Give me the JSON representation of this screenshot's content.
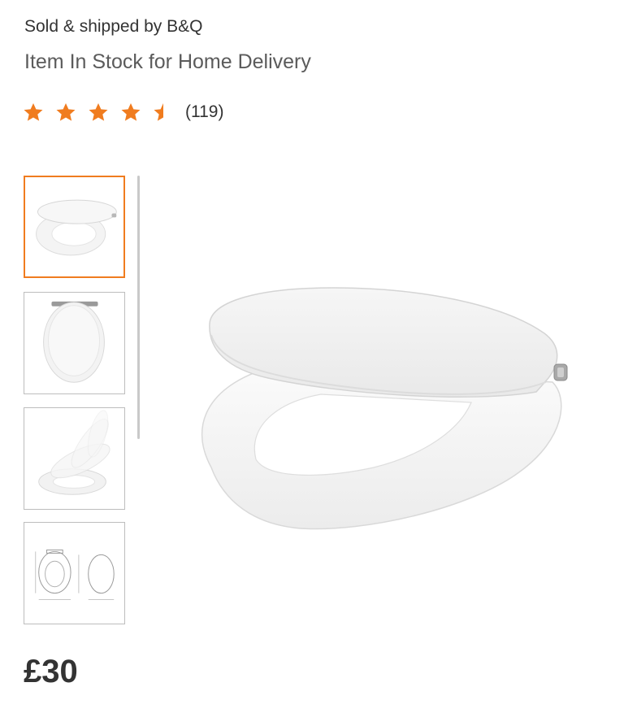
{
  "product": {
    "seller_text": "Sold & shipped by B&Q",
    "stock_text": "Item In Stock for Home Delivery",
    "price": "£30"
  },
  "rating": {
    "value": 4.5,
    "max": 5,
    "review_count_text": "(119)",
    "star_color": "#f07c1f"
  },
  "gallery": {
    "selected_index": 0,
    "thumbnails": [
      {
        "icon": "toilet-seat-open-thumbnail"
      },
      {
        "icon": "toilet-seat-closed-thumbnail"
      },
      {
        "icon": "toilet-seat-soft-close-thumbnail"
      },
      {
        "icon": "toilet-seat-dimensions-thumbnail"
      }
    ],
    "main_image_icon": "toilet-seat-main-image"
  },
  "colors": {
    "accent": "#f07c1f",
    "text": "#333333",
    "muted_text": "#5b5b5b"
  }
}
